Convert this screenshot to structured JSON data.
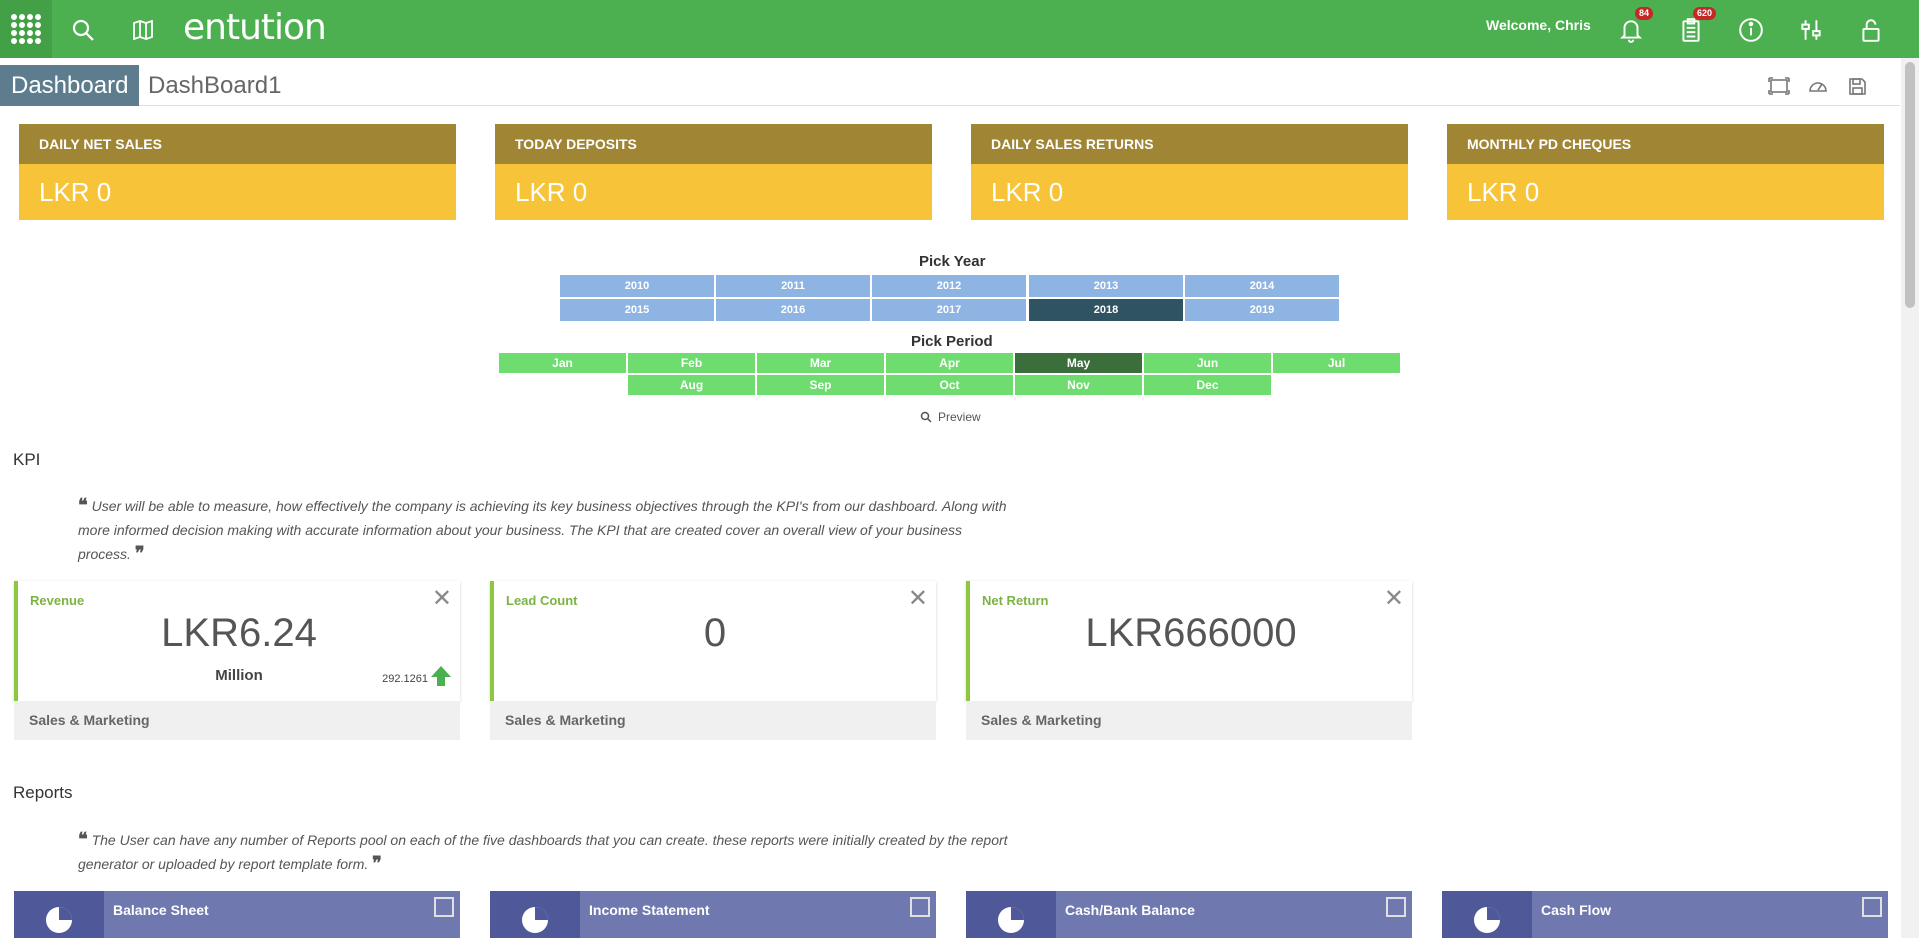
{
  "app": {
    "logo_text": "entution",
    "welcome": "Welcome, Chris",
    "notifications_count": "84",
    "tasks_count": "620",
    "colors": {
      "header": "#4caf50",
      "summary_head": "#a08535",
      "summary_body": "#f7c338",
      "kpi_accent": "#8dc63f",
      "report": "#6f79b0"
    },
    "icons": [
      "apps-grid-icon",
      "search-icon",
      "book-map-icon",
      "bell-icon",
      "clipboard-icon",
      "info-icon",
      "settings-sliders-icon",
      "lock-icon"
    ]
  },
  "titlebar": {
    "active_tab": "Dashboard",
    "dashboard_name": "DashBoard1"
  },
  "summary": [
    {
      "title": "DAILY NET SALES",
      "value": "LKR 0"
    },
    {
      "title": "TODAY DEPOSITS",
      "value": "LKR 0"
    },
    {
      "title": "DAILY SALES RETURNS",
      "value": "LKR 0"
    },
    {
      "title": "MONTHLY PD CHEQUES",
      "value": "LKR 0"
    }
  ],
  "year_picker": {
    "title": "Pick Year",
    "years": [
      "2010",
      "2011",
      "2012",
      "2013",
      "2014",
      "2015",
      "2016",
      "2017",
      "2018",
      "2019"
    ],
    "selected": "2018"
  },
  "period_picker": {
    "title": "Pick Period",
    "months": [
      "Jan",
      "Feb",
      "Mar",
      "Apr",
      "May",
      "Jun",
      "Jul",
      "Aug",
      "Sep",
      "Oct",
      "Nov",
      "Dec"
    ],
    "selected": "May"
  },
  "preview_label": "Preview",
  "kpi": {
    "title": "KPI",
    "quote": "User will be able to measure, how effectively the company is achieving its key business objectives through the KPI's from our dashboard. Along with more informed decision making with accurate information about your business. The KPI that are created cover an overall view of your business process.",
    "cards": [
      {
        "label": "Revenue",
        "value": "LKR6.24",
        "unit": "Million",
        "trend": "292.1261",
        "footer": "Sales & Marketing"
      },
      {
        "label": "Lead Count",
        "value": "0",
        "unit": "",
        "trend": "",
        "footer": "Sales & Marketing"
      },
      {
        "label": "Net Return",
        "value": "LKR666000",
        "unit": "",
        "trend": "",
        "footer": "Sales & Marketing"
      }
    ]
  },
  "reports": {
    "title": "Reports",
    "quote": "The User can have any number of Reports pool on each of the five dashboards that you can create. these reports were initially created by the report generator or uploaded by report template form.",
    "items": [
      "Balance Sheet",
      "Income Statement",
      "Cash/Bank Balance",
      "Cash Flow"
    ]
  }
}
